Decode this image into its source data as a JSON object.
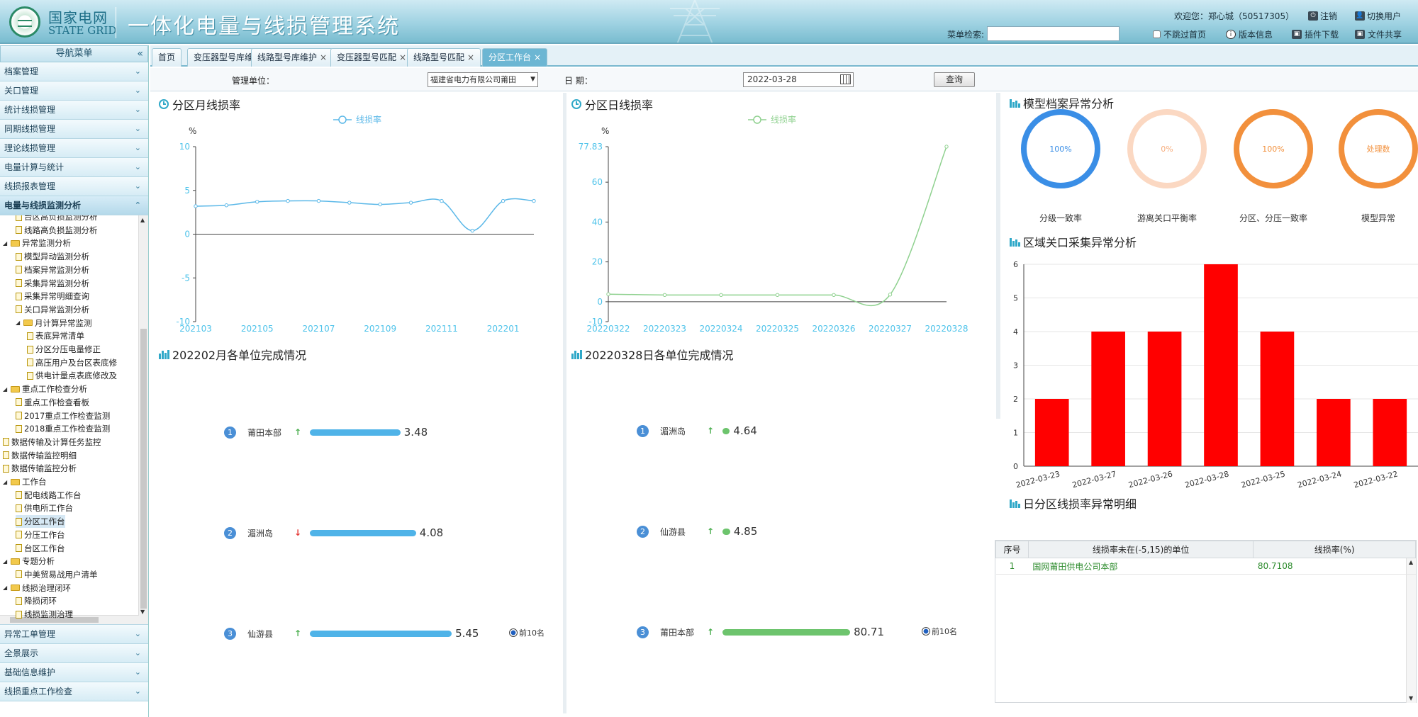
{
  "header": {
    "brand_cn": "国家电网",
    "brand_en": "STATE GRID",
    "system_title": "一体化电量与线损管理系统",
    "welcome": "欢迎您：郑心城（50517305）",
    "logout": "注销",
    "switch_user": "切换用户",
    "menu_search_label": "菜单检索:",
    "menu_search_value": "",
    "skip_home": "不跳过首页",
    "version_info": "版本信息",
    "plugin_download": "插件下载",
    "file_share": "文件共享"
  },
  "sidebar": {
    "title": "导航菜单",
    "top_items": [
      "档案管理",
      "关口管理",
      "统计线损管理",
      "同期线损管理",
      "理论线损管理",
      "电量计算与统计",
      "线损报表管理",
      "电量与线损监测分析"
    ],
    "tree": [
      {
        "label": "台区高负损监测分析",
        "level": 2,
        "icon": "file"
      },
      {
        "label": "线路高负损监测分析",
        "level": 2,
        "icon": "file"
      },
      {
        "label": "异常监测分析",
        "level": 1,
        "icon": "folder"
      },
      {
        "label": "模型异动监测分析",
        "level": 2,
        "icon": "file"
      },
      {
        "label": "档案异常监测分析",
        "level": 2,
        "icon": "file"
      },
      {
        "label": "采集异常监测分析",
        "level": 2,
        "icon": "file"
      },
      {
        "label": "采集异常明细查询",
        "level": 2,
        "icon": "file"
      },
      {
        "label": "关口异常监测分析",
        "level": 2,
        "icon": "file"
      },
      {
        "label": "月计算异常监测",
        "level": 2,
        "icon": "folder"
      },
      {
        "label": "表底异常清单",
        "level": 3,
        "icon": "file"
      },
      {
        "label": "分区分压电量修正",
        "level": 3,
        "icon": "file"
      },
      {
        "label": "高压用户及台区表底修",
        "level": 3,
        "icon": "file"
      },
      {
        "label": "供电计量点表底修改及",
        "level": 3,
        "icon": "file"
      },
      {
        "label": "重点工作检查分析",
        "level": 1,
        "icon": "folder"
      },
      {
        "label": "重点工作检查看板",
        "level": 2,
        "icon": "file"
      },
      {
        "label": "2017重点工作检查监测",
        "level": 2,
        "icon": "file"
      },
      {
        "label": "2018重点工作检查监测",
        "level": 2,
        "icon": "file"
      },
      {
        "label": "数据传输及计算任务监控",
        "level": 1,
        "icon": "file"
      },
      {
        "label": "数据传输监控明细",
        "level": 1,
        "icon": "file"
      },
      {
        "label": "数据传输监控分析",
        "level": 1,
        "icon": "file"
      },
      {
        "label": "工作台",
        "level": 1,
        "icon": "folder"
      },
      {
        "label": "配电线路工作台",
        "level": 2,
        "icon": "file"
      },
      {
        "label": "供电所工作台",
        "level": 2,
        "icon": "file"
      },
      {
        "label": "分区工作台",
        "level": 2,
        "icon": "file"
      },
      {
        "label": "分压工作台",
        "level": 2,
        "icon": "file"
      },
      {
        "label": "台区工作台",
        "level": 2,
        "icon": "file"
      },
      {
        "label": "专题分析",
        "level": 1,
        "icon": "folder"
      },
      {
        "label": "中美贸易战用户清单",
        "level": 2,
        "icon": "file"
      },
      {
        "label": "线损治理闭环",
        "level": 1,
        "icon": "folder"
      },
      {
        "label": "降损闭环",
        "level": 2,
        "icon": "file"
      },
      {
        "label": "线损监测治理",
        "level": 2,
        "icon": "file"
      }
    ],
    "bottom_items": [
      "异常工单管理",
      "全景展示",
      "基础信息维护",
      "线损重点工作检查"
    ]
  },
  "tabs": [
    "首页",
    "变压器型号库维护",
    "线路型号库维护",
    "变压器型号匹配",
    "线路型号匹配",
    "分区工作台"
  ],
  "filter": {
    "unit_label": "管理单位：",
    "unit_value": "福建省电力有限公司莆田",
    "date_label": "日 期：",
    "date_value": "2022-03-28",
    "query_button": "查询"
  },
  "monthly_panel": {
    "title": "分区月线损率"
  },
  "daily_panel": {
    "title": "分区日线损率"
  },
  "monthly_rank": {
    "title": "202202月各单位完成情况",
    "top10": "前10名",
    "rows": [
      {
        "rank": "1",
        "name": "莆田本部",
        "trend": "up",
        "arrow": "↑",
        "value": "3.48"
      },
      {
        "rank": "2",
        "name": "湄洲岛",
        "trend": "down",
        "arrow": "↓",
        "value": "4.08"
      },
      {
        "rank": "3",
        "name": "仙游县",
        "trend": "up",
        "arrow": "↑",
        "value": "5.45"
      }
    ]
  },
  "daily_rank": {
    "title": "20220328日各单位完成情况",
    "top10": "前10名",
    "rows": [
      {
        "rank": "1",
        "name": "湄洲岛",
        "trend": "up",
        "arrow": "↑",
        "value": "4.64"
      },
      {
        "rank": "2",
        "name": "仙游县",
        "trend": "up",
        "arrow": "↑",
        "value": "4.85"
      },
      {
        "rank": "3",
        "name": "莆田本部",
        "trend": "up",
        "arrow": "↑",
        "value": "80.71"
      }
    ]
  },
  "model_panel": {
    "title": "模型档案异常分析",
    "gauges": [
      {
        "center": "100%",
        "label": "分级一致率",
        "value": 100,
        "color": "#3a8ee6",
        "track": "#3a8ee6"
      },
      {
        "center": "0%",
        "label": "游离关口平衡率",
        "value": 0,
        "color": "#f7ad7d",
        "track": "#fbd8c2"
      },
      {
        "center": "100%",
        "label": "分区、分压一致率",
        "value": 100,
        "color": "#f2903c",
        "track": "#f2903c"
      },
      {
        "center": "处理数",
        "label": "模型异常",
        "value": 100,
        "color": "#f2903c",
        "track": "#f2903c"
      }
    ]
  },
  "collect_panel": {
    "title": "区域关口采集异常分析"
  },
  "detail_panel": {
    "title": "日分区线损率异常明细",
    "columns": [
      "序号",
      "线损率未在(-5,15)的单位",
      "线损率(%)"
    ],
    "rows": [
      [
        "1",
        "国网莆田供电公司本部",
        "80.7108"
      ]
    ]
  },
  "chart_data": [
    {
      "type": "line",
      "title": "分区月线损率",
      "ylabel": "%",
      "series": [
        {
          "name": "线损率",
          "values": [
            3.2,
            3.3,
            3.7,
            3.8,
            3.8,
            3.6,
            3.4,
            3.6,
            3.8,
            0.4,
            3.8,
            3.8
          ]
        }
      ],
      "x": [
        "202103",
        "202104",
        "202105",
        "202106",
        "202107",
        "202108",
        "202109",
        "202110",
        "202111",
        "202112",
        "202201",
        "202202"
      ],
      "tick_labels": [
        "202103",
        "202105",
        "202107",
        "202109",
        "202111",
        "202201"
      ],
      "ylim": [
        -10,
        10
      ],
      "yticks": [
        "10",
        "5",
        "0",
        "-5",
        "-10"
      ],
      "color": "#5bb8e8"
    },
    {
      "type": "line",
      "title": "分区日线损率",
      "ylabel": "%",
      "series": [
        {
          "name": "线损率",
          "values": [
            3.8,
            3.4,
            3.4,
            3.4,
            3.4,
            3.6,
            77.83
          ]
        }
      ],
      "x": [
        "20220322",
        "20220323",
        "20220324",
        "20220325",
        "20220326",
        "20220327",
        "20220328"
      ],
      "ylim": [
        -10,
        77.83
      ],
      "yticks": [
        "77.83",
        "60",
        "40",
        "20",
        "0",
        "-10"
      ],
      "color": "#8fd18f"
    },
    {
      "type": "bar",
      "title": "区域关口采集异常分析",
      "categories": [
        "2022-03-23",
        "2022-03-27",
        "2022-03-26",
        "2022-03-28",
        "2022-03-25",
        "2022-03-24",
        "2022-03-22"
      ],
      "values": [
        2,
        4,
        4,
        6,
        4,
        2,
        2
      ],
      "ylim": [
        0,
        6
      ],
      "color": "#ff0000"
    },
    {
      "type": "bar",
      "title": "202202月各单位完成情况",
      "categories": [
        "莆田本部",
        "湄洲岛",
        "仙游县"
      ],
      "values": [
        3.48,
        4.08,
        5.45
      ],
      "color": "#4fb3e8"
    },
    {
      "type": "bar",
      "title": "20220328日各单位完成情况",
      "categories": [
        "湄洲岛",
        "仙游县",
        "莆田本部"
      ],
      "values": [
        4.64,
        4.85,
        80.71
      ],
      "color": "#6dc46d"
    }
  ]
}
